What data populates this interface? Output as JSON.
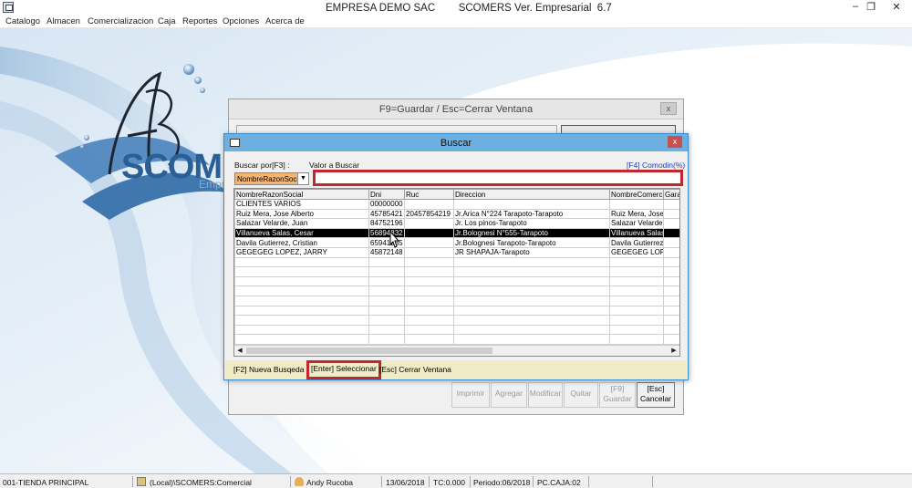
{
  "window": {
    "title_left": "EMPRESA DEMO SAC",
    "title_right": "SCOMERS Ver. Empresarial  6.7",
    "minimize_glyph": "–",
    "restore_glyph": "❐",
    "close_glyph": "✕"
  },
  "menu": [
    "Catalogo",
    "Almacen",
    "Comercializacion",
    "Caja",
    "Reportes",
    "Opciones",
    "Acerca de"
  ],
  "logo": {
    "text": "SCOMER",
    "subtext": "Empr"
  },
  "back_window": {
    "title": "F9=Guardar / Esc=Cerrar Ventana",
    "close_glyph": "x",
    "buttons": [
      "Imprimir",
      "Agregar",
      "Modificar",
      "Quitar"
    ],
    "guardar": {
      "key": "[F9]",
      "label": "Guardar"
    },
    "cancelar": {
      "key": "[Esc]",
      "label": "Cancelar"
    }
  },
  "dialog": {
    "title": "Buscar",
    "close_glyph": "x",
    "buscar_por_label": "Buscar por[F3] :",
    "valor_label": "Valor a Buscar",
    "comodin_label": "[F4] Comodin(%)",
    "combo_value": "NombreRazonSocial",
    "search_value": "",
    "columns": [
      "NombreRazonSocial",
      "Dni",
      "Ruc",
      "Direccion",
      "NombreComercial",
      "Gara"
    ],
    "rows": [
      [
        "CLIENTES VARIOS",
        "00000000",
        "",
        "",
        "",
        ""
      ],
      [
        "Ruiz Mera, Jose Alberto",
        "45785421",
        "20457854219",
        "Jr.Arica N°224 Tarapoto-Tarapoto",
        "Ruiz  Mera, Jose",
        ""
      ],
      [
        "Salazar Velarde, Juan",
        "84752196",
        "",
        "Jr. Los pinos-Tarapoto",
        "Salazar Velarde,",
        ""
      ],
      [
        "Villanueva  Salas, Cesar",
        "56894832",
        "",
        "Jr.Bolognesi N°555-Tarapoto",
        "Villanueva  Salas",
        ""
      ],
      [
        "Davila Gutierrez, Cristian",
        "65941235",
        "",
        "Jr.Bolognesi Tarapoto-Tarapoto",
        "Davila Gutierrez",
        ""
      ],
      [
        "GEGEGEG LOPEZ, JARRY",
        "45872148",
        "",
        "JR SHAPAJA-Tarapoto",
        "GEGEGEG LOPEZ",
        ""
      ]
    ],
    "selected_row": 3,
    "footer": {
      "nueva": "[F2] Nueva Busqeda",
      "seleccionar": "[Enter] Seleccionar",
      "cerrar": "[Esc] Cerrar Ventana"
    }
  },
  "status": {
    "tienda": "001-TIENDA PRINCIPAL",
    "server": "(Local)\\SCOMERS:Comercial",
    "user": "Andy Rucoba",
    "date": "13/06/2018",
    "tc": "TC:0.000",
    "periodo": "Periodo:06/2018",
    "caja": "PC.CAJA:02"
  },
  "colors": {
    "accent_highlight": "#c1272d",
    "dialog_title": "#6db0e0",
    "footer_bg": "#efecc6",
    "combo_bg": "#f6b46f",
    "logo_blue": "#2a5f95"
  }
}
